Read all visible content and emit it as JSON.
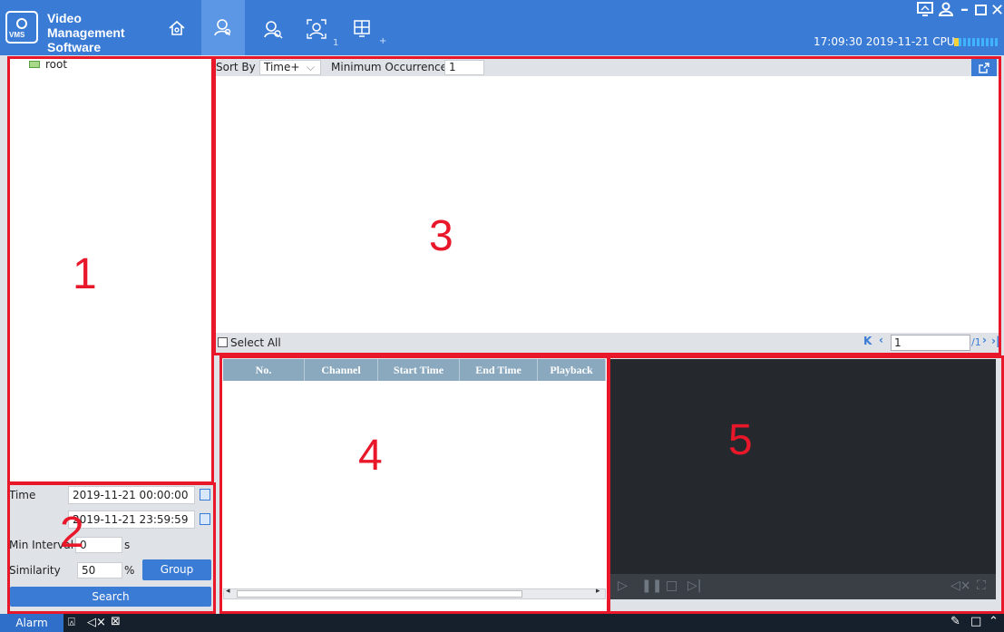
{
  "app": {
    "title_line1": "Video Management",
    "title_line2": "Software",
    "logo_text": "VMS"
  },
  "nav": {
    "tab4_sub": "1",
    "tab5_sub": "+"
  },
  "status": {
    "datetime": "17:09:30 2019-11-21",
    "cpu_label": "CPU"
  },
  "tree": {
    "root_label": "root"
  },
  "search": {
    "time_label": "Time",
    "start_time": "2019-11-21 00:00:00",
    "end_time": "2019-11-21 23:59:59",
    "min_interval_label": "Min Interval",
    "min_interval_value": "0",
    "min_interval_unit": "s",
    "similarity_label": "Similarity",
    "similarity_value": "50",
    "similarity_unit": "%",
    "group_button": "Group",
    "search_button": "Search"
  },
  "results": {
    "sort_by_label": "Sort By",
    "sort_by_value": "Time+",
    "min_occ_label": "Minimum Occurrences",
    "min_occ_value": "1",
    "select_all_label": "Select All",
    "page_current": "1",
    "page_total": "/1"
  },
  "table": {
    "columns": [
      "No.",
      "Channel",
      "Start Time",
      "End Time",
      "Playback"
    ]
  },
  "annotations": {
    "n1": "1",
    "n2": "2",
    "n3": "3",
    "n4": "4",
    "n5": "5"
  },
  "bottom": {
    "alarm_tab": "Alarm"
  },
  "colors": {
    "accent": "#3a7bd5",
    "annotation_red": "#e8172a",
    "header_blue": "#8aa8be"
  }
}
